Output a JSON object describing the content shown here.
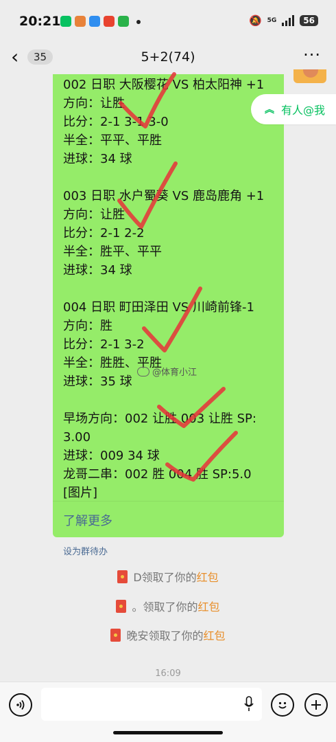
{
  "status_bar": {
    "time": "20:21",
    "network": "5G",
    "battery": "56"
  },
  "header": {
    "back_count": "35",
    "title": "5+2(74)"
  },
  "mention": {
    "label": "有人@我"
  },
  "message": {
    "lines": [
      "002 日职 大阪樱花 VS 柏太阳神 +1",
      "方向：让胜",
      "比分：2-1 3-1 3-0",
      "半全：平平、平胜",
      "进球：34 球",
      "",
      "003 日职 水户蜀葵 VS 鹿岛鹿角 +1",
      "方向：让胜",
      "比分：2-1 2-2",
      "半全：胜平、平平",
      "进球：34 球",
      "",
      "004 日职 町田泽田 VS 川崎前锋-1",
      "方向：胜",
      "比分：2-1 3-2",
      "半全：胜胜、平胜",
      "进球：35 球",
      "",
      "早场方向：002 让胜 003 让胜 SP:",
      "3.00",
      "进球：009  34 球",
      "龙哥二串：002 胜 004 胜 SP:5.0",
      "[图片]"
    ],
    "learn_more": "了解更多"
  },
  "watermark": "@体育小江",
  "set_todo": "设为群待办",
  "system_messages": [
    {
      "who": "D领取了你的",
      "red_packet": "红包"
    },
    {
      "who": "。领取了你的",
      "red_packet": "红包"
    },
    {
      "who": "晚安领取了你的",
      "red_packet": "红包"
    }
  ],
  "timestamp": "16:09",
  "colors": {
    "bubble": "#95ec69",
    "accent_green": "#07c160",
    "check_red": "#e8323a",
    "red_packet_text": "#e88f2c"
  },
  "icons": [
    "voice-icon",
    "microphone-icon",
    "emoji-icon",
    "plus-icon",
    "back-chevron-icon",
    "more-dots-icon"
  ]
}
